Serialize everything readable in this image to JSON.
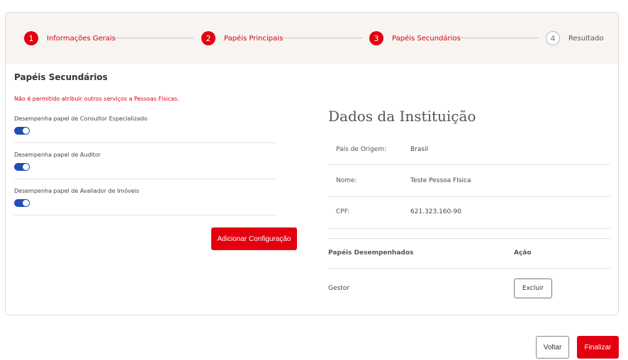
{
  "stepper": {
    "steps": [
      {
        "number": "1",
        "label": "Informações Gerais",
        "state": "done"
      },
      {
        "number": "2",
        "label": "Papéis Principais",
        "state": "done"
      },
      {
        "number": "3",
        "label": "Papéis Secundários",
        "state": "active"
      },
      {
        "number": "4",
        "label": "Resultado",
        "state": "pending"
      }
    ]
  },
  "secondary_roles": {
    "title": "Papéis Secundários",
    "warning": "Não é permitido atribuir outros serviços a Pessoas Físicas.",
    "toggles": [
      {
        "label": "Desempenha papel de Consultor Especializado",
        "on": true
      },
      {
        "label": "Desempenha papel de Auditor",
        "on": true
      },
      {
        "label": "Desempenha papel de Avaliador de Imóveis",
        "on": true
      }
    ],
    "add_button": "Adicionar Configuração"
  },
  "institution": {
    "title": "Dados da Instituição",
    "fields": [
      {
        "key": "País de Origem:",
        "value": "Brasil"
      },
      {
        "key": "Nome:",
        "value": "Teste Pessoa FIsica"
      },
      {
        "key": "CPF:",
        "value": "621.323.160-90"
      }
    ],
    "table": {
      "headers": [
        "Papéis Desempenhados",
        "Ação"
      ],
      "rows": [
        {
          "role": "Gestor",
          "action": "Excluir"
        }
      ]
    }
  },
  "footer": {
    "back": "Voltar",
    "finish": "Finalizar"
  },
  "colors": {
    "accent": "#e3000f",
    "toggle": "#1f4fb5",
    "stepper_bg": "#f7f4f1"
  }
}
